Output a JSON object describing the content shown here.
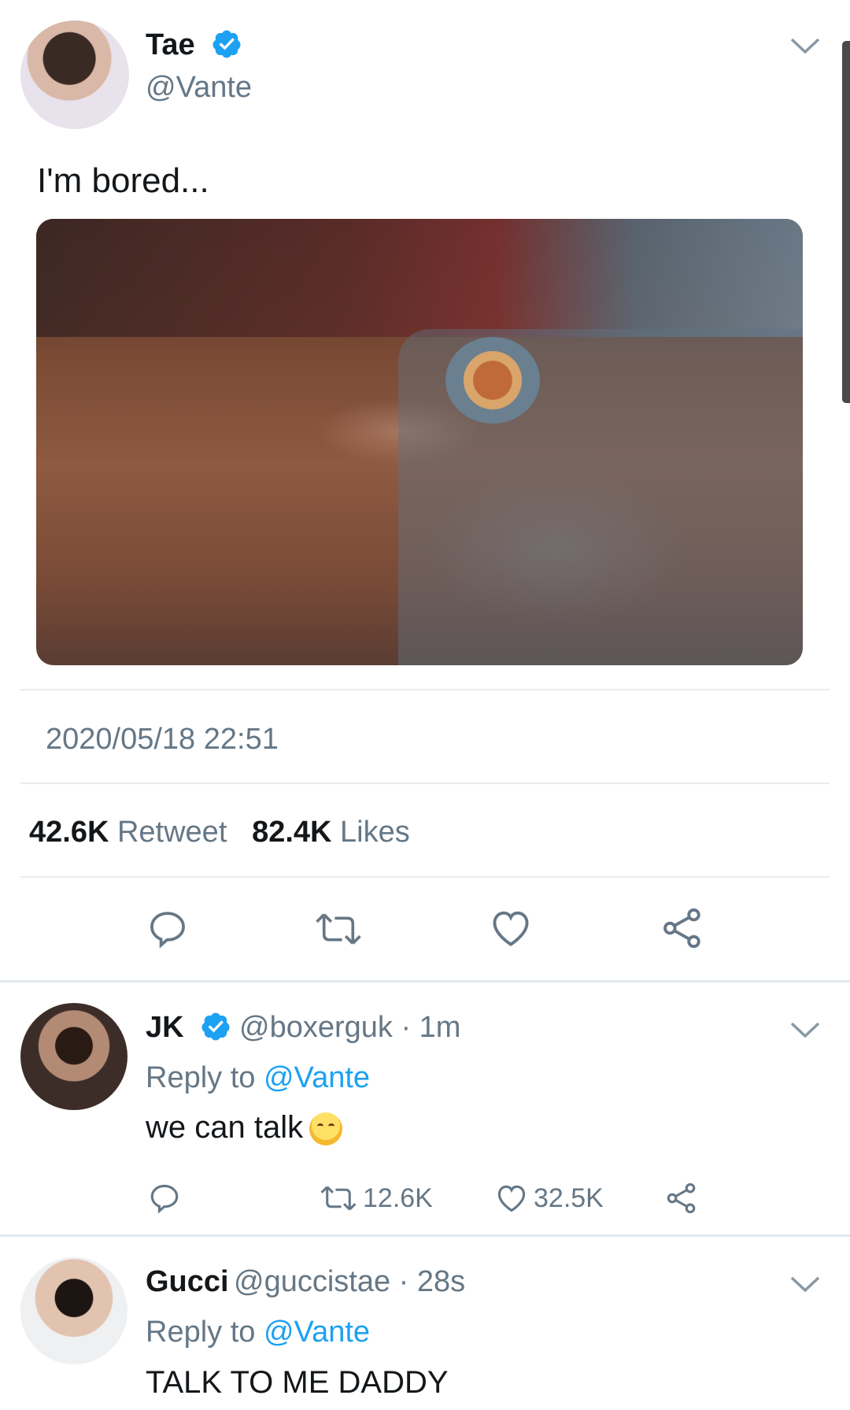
{
  "main_tweet": {
    "author": "Tae",
    "handle": "@Vante",
    "text": "I'm bored...",
    "timestamp": "2020/05/18 22:51",
    "retweet_count": "42.6K",
    "retweet_label": "Retweet",
    "like_count": "82.4K",
    "like_label": "Likes"
  },
  "replies": [
    {
      "author": "JK",
      "handle_time": "@boxerguk · 1m",
      "reply_prefix": "Reply to ",
      "reply_mention": "@Vante",
      "text": "we can talk",
      "retweets": "12.6K",
      "likes": "32.5K"
    },
    {
      "author": "Gucci",
      "handle_time": "@guccistae · 28s",
      "reply_prefix": "Reply to ",
      "reply_mention": "@Vante",
      "text": "TALK TO ME DADDY"
    }
  ],
  "colors": {
    "accent": "#1da1f2",
    "secondary_text": "#657786",
    "primary_text": "#14171a",
    "divider": "#e6ecf0"
  },
  "icons": [
    "verified-icon",
    "chevron-down-icon",
    "reply-icon",
    "retweet-icon",
    "heart-icon",
    "share-icon"
  ]
}
